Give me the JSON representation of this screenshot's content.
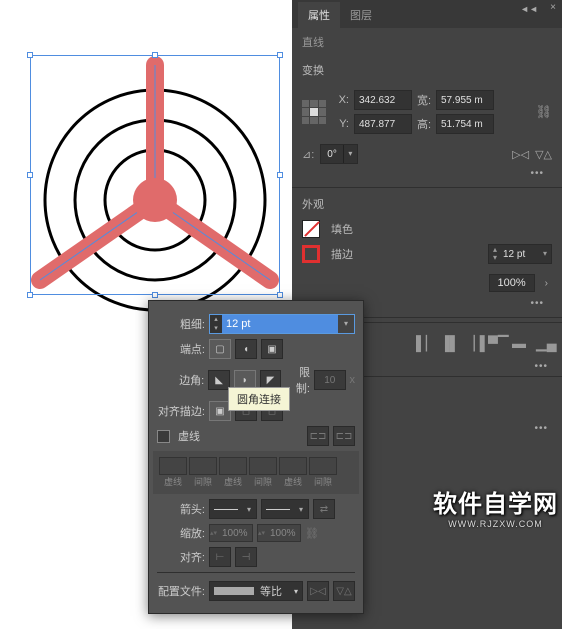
{
  "tabs": {
    "properties": "属性",
    "layers": "图层"
  },
  "subtype": "直线",
  "transform": {
    "title": "变换",
    "x_label": "X:",
    "x": "342.632",
    "y_label": "Y:",
    "y": "487.877",
    "w_label": "宽:",
    "w": "57.955 m",
    "h_label": "高:",
    "h": "51.754 m",
    "angle": "0°"
  },
  "appearance": {
    "title": "外观",
    "fill_label": "填色",
    "stroke_label": "描边",
    "stroke_weight": "12 pt",
    "opacity": "100%"
  },
  "stroke_popup": {
    "weight_label": "粗细:",
    "weight_value": "12 pt",
    "cap_label": "端点:",
    "corner_label": "边角:",
    "limit_label": "限制:",
    "limit_value": "10",
    "limit_unit": "x",
    "align_label": "对齐描边:",
    "tooltip": "圆角连接",
    "dashed_label": "虚线",
    "dash_labels": [
      "虚线",
      "间隙",
      "虚线",
      "间隙",
      "虚线",
      "间隙"
    ],
    "arrow_label": "箭头:",
    "scale_label": "缩放:",
    "scale_value": "100%",
    "align_arrow_label": "对齐:",
    "profile_label": "配置文件:",
    "profile_value": "等比"
  },
  "watermark": {
    "main": "软件自学网",
    "sub": "WWW.RJZXW.COM"
  }
}
